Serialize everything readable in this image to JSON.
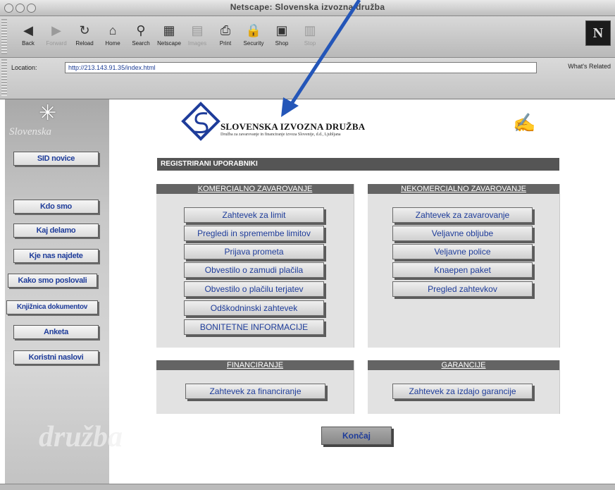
{
  "window": {
    "title": "Netscape: Slovenska izvozna družba"
  },
  "toolbar": {
    "buttons": [
      {
        "label": "Back",
        "icon": "back-icon",
        "enabled": true
      },
      {
        "label": "Forward",
        "icon": "forward-icon",
        "enabled": false
      },
      {
        "label": "Reload",
        "icon": "reload-icon",
        "enabled": true
      },
      {
        "label": "Home",
        "icon": "home-icon",
        "enabled": true
      },
      {
        "label": "Search",
        "icon": "search-icon",
        "enabled": true
      },
      {
        "label": "Netscape",
        "icon": "netscape-icon",
        "enabled": true
      },
      {
        "label": "Images",
        "icon": "images-icon",
        "enabled": false
      },
      {
        "label": "Print",
        "icon": "print-icon",
        "enabled": true
      },
      {
        "label": "Security",
        "icon": "security-icon",
        "enabled": true
      },
      {
        "label": "Shop",
        "icon": "shop-icon",
        "enabled": true
      },
      {
        "label": "Stop",
        "icon": "stop-icon",
        "enabled": false
      }
    ]
  },
  "location": {
    "label": "Location:",
    "url": "http://213.143.91.35/index.html",
    "related": "What's Related"
  },
  "sidebar": {
    "brand": "Slovenska",
    "watermark": "družba",
    "items": [
      {
        "label": "SID novice"
      },
      {
        "label": "Kdo smo"
      },
      {
        "label": "Kaj delamo"
      },
      {
        "label": "Kje nas najdete"
      },
      {
        "label": "Kako smo poslovali"
      },
      {
        "label": "Knjižnica dokumentov"
      },
      {
        "label": "Anketa"
      },
      {
        "label": "Koristni naslovi"
      }
    ]
  },
  "header": {
    "company": "SLOVENSKA IZVOZNA DRUŽBA",
    "subtitle": "Družba za zavarovanje in financiranje izvoza Slovenije, d.d., Ljubljana"
  },
  "main": {
    "section_title": "REGISTRIRANI UPORABNIKI",
    "komercialno": {
      "title": "KOMERCIALNO ZAVAROVANJE",
      "buttons": [
        "Zahtevek za limit",
        "Pregledi in spremembe limitov",
        "Prijava prometa",
        "Obvestilo o zamudi plačila",
        "Obvestilo o plačilu terjatev",
        "Odškodninski zahtevek",
        "BONITETNE INFORMACIJE"
      ]
    },
    "nekomercialno": {
      "title": "NEKOMERCIALNO ZAVAROVANJE",
      "buttons": [
        "Zahtevek za zavarovanje",
        "Veljavne obljube",
        "Veljavne police",
        "Knaepen paket",
        "Pregled zahtevkov"
      ]
    },
    "financiranje": {
      "title": "FINANCIRANJE",
      "button": "Zahtevek za financiranje"
    },
    "garancije": {
      "title": "GARANCIJE",
      "button": "Zahtevek za izdajo garancije"
    },
    "finish": "Končaj"
  },
  "colors": {
    "link": "#1e3c9a",
    "arrow": "#2456b8",
    "header_bar": "#555555"
  }
}
